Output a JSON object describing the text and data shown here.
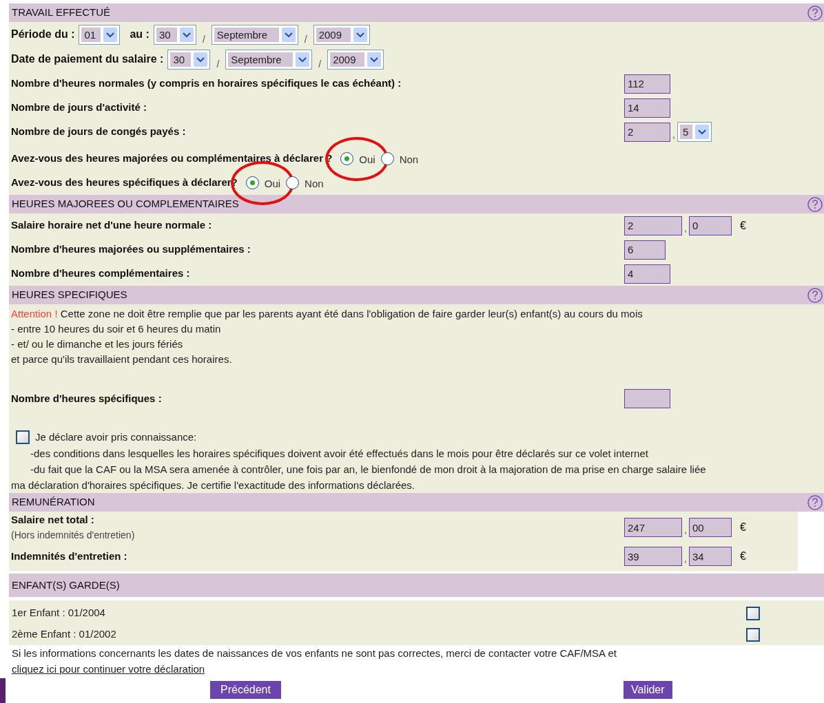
{
  "travail": {
    "title": "TRAVAIL EFFECTUÉ",
    "periode": {
      "label": "Période du :",
      "from_day": "01",
      "to_label": "au :",
      "to_day": "30",
      "sep1": "/",
      "month": "Septembre",
      "sep2": "/",
      "year": "2009"
    },
    "paiement": {
      "label": "Date de paiement du salaire :",
      "day": "30",
      "sep1": "/",
      "month": "Septembre",
      "sep2": "/",
      "year": "2009"
    },
    "fields": [
      {
        "label": "Nombre d'heures normales (y compris en horaires spécifiques le cas échéant) :",
        "value": "112"
      },
      {
        "label": "Nombre de jours d'activité :",
        "value": "14"
      },
      {
        "label": "Nombre de jours de congés payés :",
        "value": "2",
        "sep": ",",
        "decimal": "5"
      }
    ],
    "questions": [
      {
        "label": "Avez-vous des heures majorées ou complémentaires à déclarer ?",
        "options": [
          {
            "label": "Oui",
            "selected": true,
            "circled": true
          },
          {
            "label": "Non",
            "selected": false,
            "circled": false
          }
        ]
      },
      {
        "label": "Avez-vous des heures spécifiques à déclarer?",
        "options": [
          {
            "label": "Oui",
            "selected": true,
            "circled": true
          },
          {
            "label": "Non",
            "selected": false,
            "circled": false
          }
        ]
      }
    ]
  },
  "majorees": {
    "title": "HEURES MAJOREES OU COMPLEMENTAIRES",
    "fields": [
      {
        "label": "Salaire horaire net d'une heure normale :",
        "value": "2",
        "sep": ",",
        "cents": "0",
        "unit": "€"
      },
      {
        "label": "Nombre d'heures majorées ou supplémentaires :",
        "value": "6"
      },
      {
        "label": "Nombre d'heures complémentaires :",
        "value": "4"
      }
    ]
  },
  "specifiques": {
    "title": "HEURES SPECIFIQUES",
    "warning": "Attention !",
    "intro": "Cette zone ne doit être remplie que par les parents ayant été dans l'obligation de faire garder leur(s) enfant(s) au cours du mois",
    "lines": [
      "- entre 10 heures du soir et 6 heures du matin",
      "- et/ ou le dimanche et les jours fériés",
      "et parce qu'ils travaillaient pendant ces horaires."
    ],
    "field": {
      "label": "Nombre d'heures spécifiques :"
    },
    "consent": {
      "label": "Je déclare avoir pris connaissance:",
      "checked": false,
      "lines": [
        "-des conditions dans lesquelles les horaires spécifiques doivent avoir été effectués dans le mois pour être déclarés sur ce volet internet",
        "-du fait que la CAF ou la MSA sera amenée à contrôler, une fois par an, le bienfondé de mon droit à la majoration de ma prise en charge salaire liée",
        "ma déclaration d'horaires spécifiques. Je certifie l'exactitude des informations déclarées."
      ]
    }
  },
  "remuneration": {
    "title": "REMUNÉRATION",
    "fields": [
      {
        "label": "Salaire net total :",
        "note": "(Hors indemnités d'entretien)",
        "value": "247",
        "sep": ",",
        "cents": "00",
        "unit": "€"
      },
      {
        "label": "Indemnités d'entretien :",
        "value": "39",
        "sep": ",",
        "cents": "34",
        "unit": "€"
      }
    ]
  },
  "enfants": {
    "title": "ENFANT(S) GARDE(S)",
    "children": [
      {
        "label": "1er Enfant : 01/2004",
        "checked": false
      },
      {
        "label": "2ème Enfant : 01/2002",
        "checked": false
      }
    ],
    "note": "Si les informations concernants les dates de naissances de vos enfants ne sont pas correctes, merci de contacter votre CAF/MSA et",
    "link": "cliquez ici pour continuer votre déclaration"
  },
  "buttons": [
    {
      "label": "Précédent"
    },
    {
      "label": "Valider"
    }
  ]
}
